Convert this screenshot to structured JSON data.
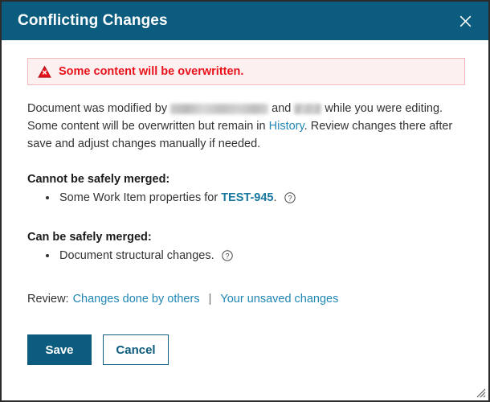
{
  "dialog": {
    "title": "Conflicting Changes",
    "close_icon": "close-icon"
  },
  "alert": {
    "icon": "warning-triangle-icon",
    "message": "Some content will be overwritten.",
    "text_color": "#e8121a",
    "background_color": "#fdf0f1",
    "border_color": "#f4b7bc"
  },
  "body": {
    "line1_part1": "Document was modified by ",
    "line1_redacted_user1": "",
    "line1_part2": " and ",
    "line1_redacted_user2": "",
    "line1_part3": " while you were editing.",
    "line2_part1": "Some content will be overwritten but remain in ",
    "history_link": "History",
    "line2_part2": ". Review changes there after save and adjust changes manually if needed."
  },
  "sections": [
    {
      "heading": "Cannot be safely merged:",
      "items": [
        {
          "text_before": "Some Work Item properties for ",
          "link": "TEST-945",
          "text_after": ".",
          "help_icon": "help-circle-icon"
        }
      ]
    },
    {
      "heading": "Can be safely merged:",
      "items": [
        {
          "text_before": "Document structural changes.",
          "link": "",
          "text_after": "",
          "help_icon": "help-circle-icon"
        }
      ]
    }
  ],
  "review": {
    "label": "Review:",
    "link_others": "Changes done by others",
    "separator": "|",
    "link_unsaved": "Your unsaved changes"
  },
  "actions": {
    "save_label": "Save",
    "cancel_label": "Cancel"
  },
  "theme": {
    "header_color": "#0b5c7e",
    "link_color": "#1f86b3",
    "accent_color": "#1878a0"
  }
}
